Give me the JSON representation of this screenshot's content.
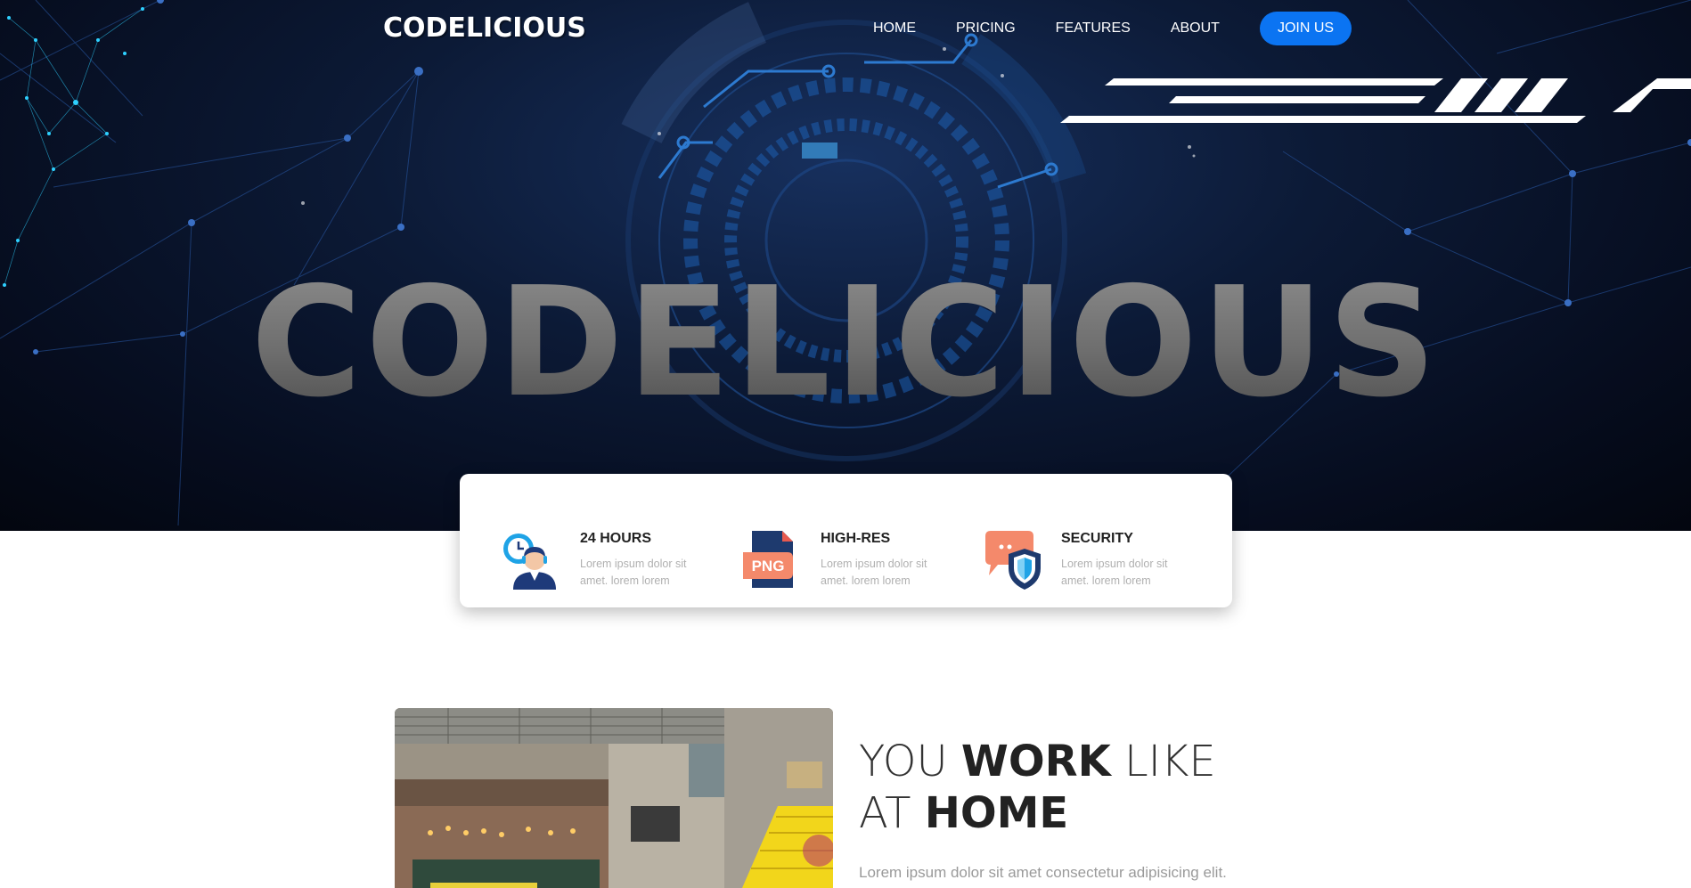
{
  "brand": {
    "logo": "CODELICIOUS"
  },
  "nav": {
    "items": [
      "HOME",
      "PRICING",
      "FEATURES",
      "ABOUT"
    ],
    "cta": "JOIN US"
  },
  "hero": {
    "title": "CODELICIOUS"
  },
  "features": [
    {
      "title": "24 HOURS",
      "desc": "Lorem ipsum dolor sit amet. lorem lorem",
      "icon": "support-agent-clock-icon"
    },
    {
      "title": "HIGH-RES",
      "desc": "Lorem ipsum dolor sit amet. lorem lorem",
      "icon": "png-file-icon",
      "badge": "PNG"
    },
    {
      "title": "SECURITY",
      "desc": "Lorem ipsum dolor sit amet. lorem lorem",
      "icon": "chat-shield-icon"
    }
  ],
  "about": {
    "heading_line1_light": "YOU ",
    "heading_line1_bold": "WORK",
    "heading_line1_light2": " LIKE",
    "heading_line2_light": "AT ",
    "heading_line2_bold": "HOME",
    "lead": "Lorem ipsum dolor sit amet consectetur adipisicing elit."
  },
  "colors": {
    "accent": "#0b74f2",
    "hero_dark": "#060d1f",
    "circuit_blue": "#1e5fb0"
  }
}
